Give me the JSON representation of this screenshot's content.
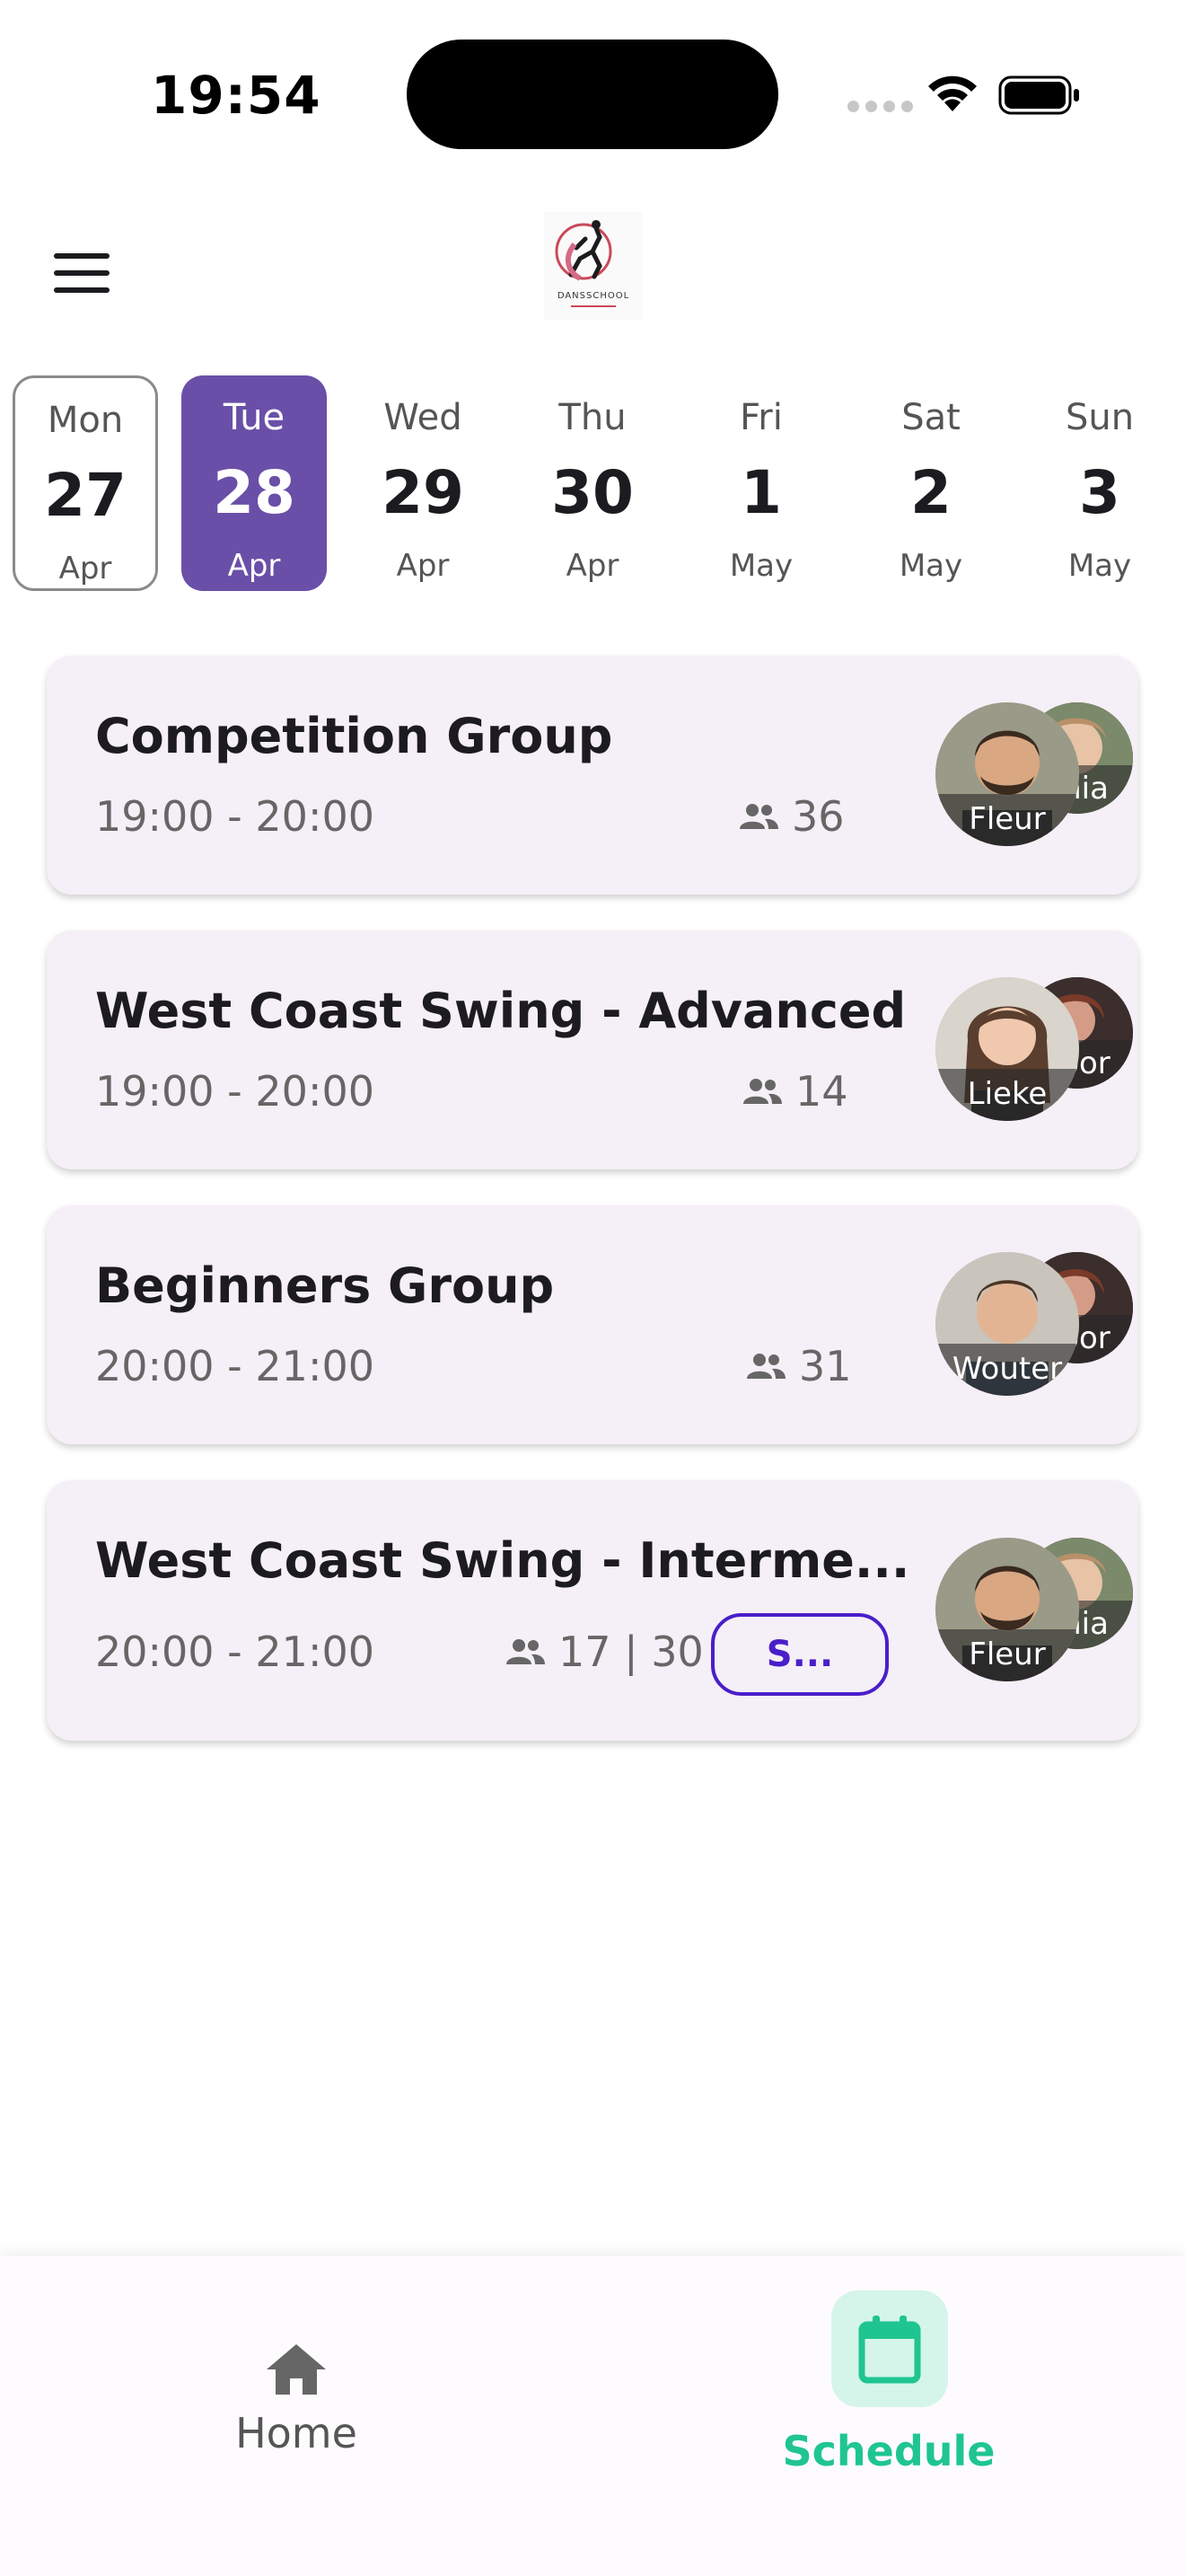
{
  "status_bar": {
    "time": "19:54"
  },
  "header": {
    "logo_name": "dansschool-logo",
    "logo_text": "DANSSCHOOL"
  },
  "dates": [
    {
      "day": "Mon",
      "num": "27",
      "month": "Apr"
    },
    {
      "day": "Tue",
      "num": "28",
      "month": "Apr"
    },
    {
      "day": "Wed",
      "num": "29",
      "month": "Apr"
    },
    {
      "day": "Thu",
      "num": "30",
      "month": "Apr"
    },
    {
      "day": "Fri",
      "num": "1",
      "month": "May"
    },
    {
      "day": "Sat",
      "num": "2",
      "month": "May"
    },
    {
      "day": "Sun",
      "num": "3",
      "month": "May"
    }
  ],
  "classes": [
    {
      "title": "Competition Group",
      "time": "19:00 - 20:00",
      "count": "36",
      "teacher_front": "Fleur",
      "teacher_back": "nia"
    },
    {
      "title": "West Coast Swing - Advanced",
      "time": "19:00 - 20:00",
      "count": "14",
      "teacher_front": "Lieke",
      "teacher_back": "oor"
    },
    {
      "title": "Beginners Group",
      "time": "20:00 - 21:00",
      "count": "31",
      "teacher_front": "Wouter",
      "teacher_back": "oor"
    },
    {
      "title": "West Coast Swing - Interme...",
      "time": "20:00 - 21:00",
      "count": "17 | 30",
      "button": "S...",
      "teacher_front": "Fleur",
      "teacher_back": "nia"
    }
  ],
  "nav": {
    "home": "Home",
    "schedule": "Schedule"
  },
  "colors": {
    "selected_day": "#6a4fa8",
    "card_bg": "#f5eff7",
    "accent_green": "#1fc590",
    "button_border": "#4a1ec9"
  }
}
